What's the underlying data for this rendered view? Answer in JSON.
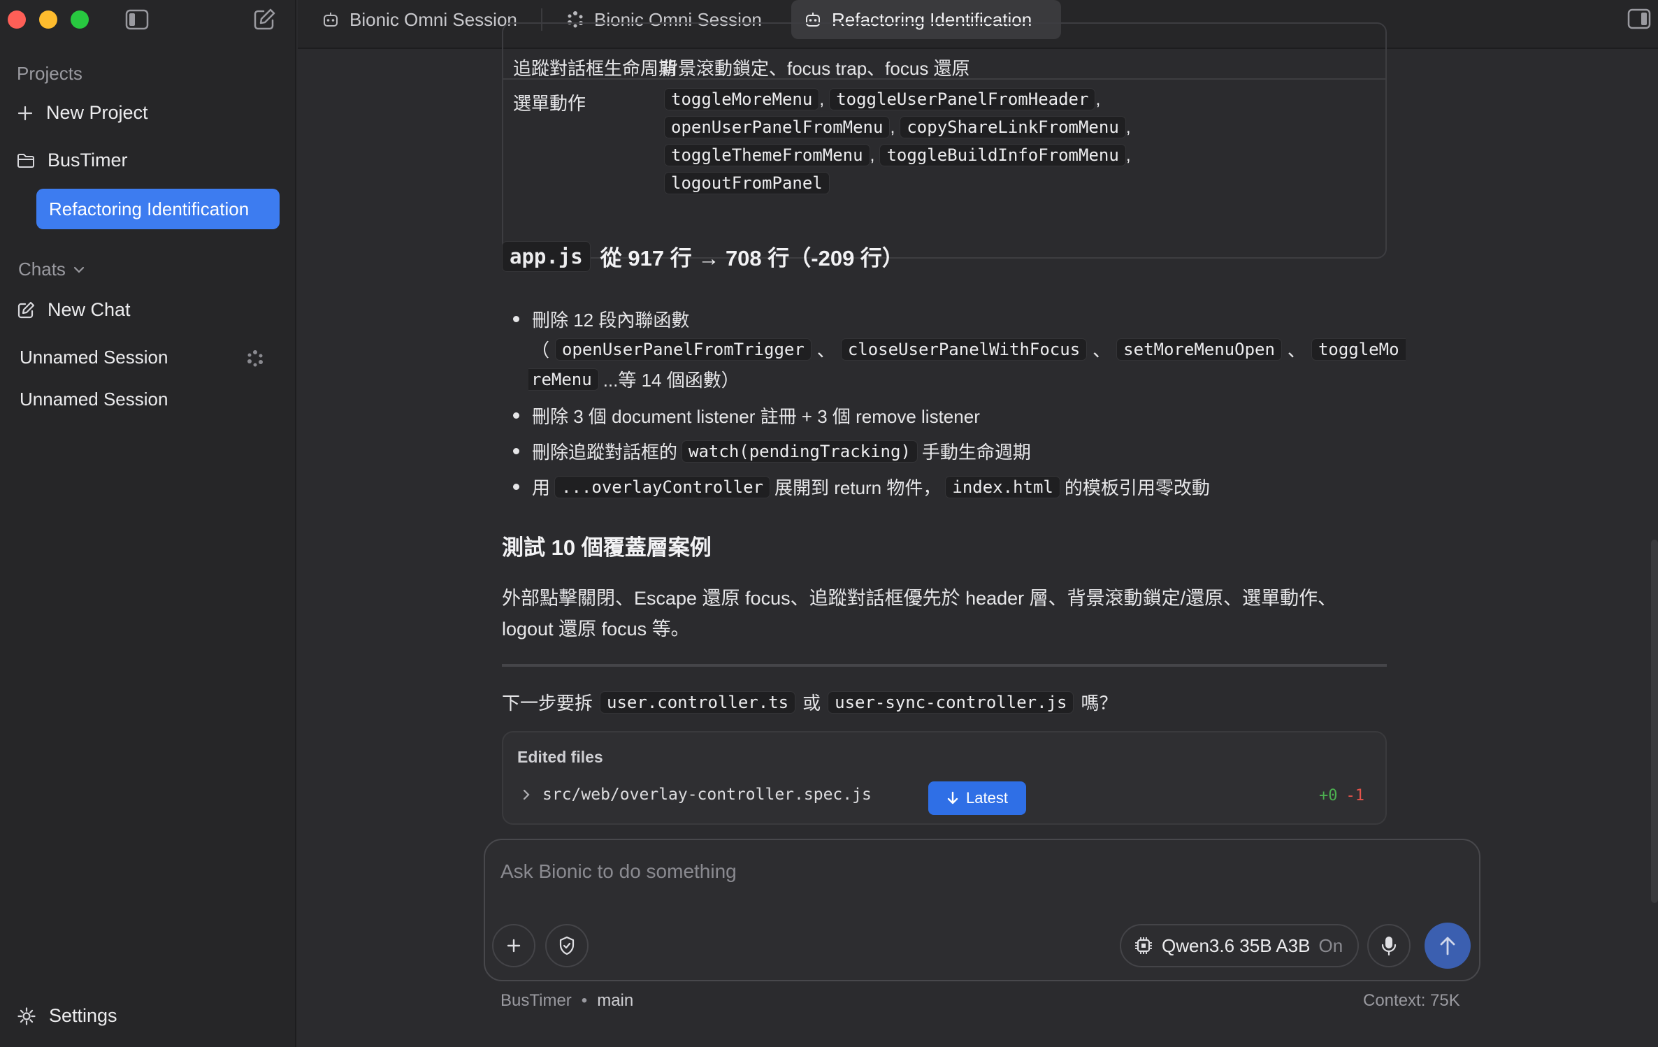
{
  "sidebar": {
    "projects_label": "Projects",
    "new_project": "New Project",
    "project_name": "BusTimer",
    "active_session": "Refactoring Identification",
    "chats_label": "Chats",
    "new_chat": "New Chat",
    "sessions": [
      "Unnamed Session",
      "Unnamed Session"
    ],
    "settings": "Settings"
  },
  "tabs": [
    {
      "label": "Bionic Omni Session",
      "icon": "robot-icon"
    },
    {
      "label": "Bionic Omni Session",
      "icon": "sparkle-icon"
    },
    {
      "label": "Refactoring Identification",
      "icon": "robot-icon",
      "active": true
    }
  ],
  "table": {
    "row1": {
      "key": "追蹤對話框生命周期",
      "value": "背景滾動鎖定、focus trap、focus 還原"
    },
    "row2": {
      "key": "選單動作",
      "funcs": [
        "toggleMoreMenu",
        "toggleUserPanelFromHeader",
        "openUserPanelFromMenu",
        "copyShareLinkFromMenu",
        "toggleThemeFromMenu",
        "toggleBuildInfoFromMenu",
        "logoutFromPanel"
      ],
      "sep": ","
    }
  },
  "section1": {
    "file": "app.js",
    "title_rest": "從 917 行 → 708 行（-209 行）",
    "bullets": {
      "b1_text": "刪除 12 段內聯函數",
      "b1_open": "（",
      "b1_funcs": [
        "openUserPanelFromTrigger",
        "closeUserPanelWithFocus",
        "setMoreMenuOpen",
        "toggleMo"
      ],
      "b1_wrap_code": "reMenu",
      "b1_tail": "...等 14 個函數）",
      "dun": "、",
      "b2": "刪除 3 個 document listener 註冊 + 3 個 remove listener",
      "b3_pre": "刪除追蹤對話框的",
      "b3_code": "watch(pendingTracking)",
      "b3_post": "手動生命週期",
      "b4_pre": "用",
      "b4_code1": "...overlayController",
      "b4_mid": "展開到 return 物件，",
      "b4_code2": "index.html",
      "b4_post": "的模板引用零改動"
    }
  },
  "section2": {
    "title": "測試 10 個覆蓋層案例",
    "line1": "外部點擊關閉、Escape 還原 focus、追蹤對話框優先於 header 層、背景滾動鎖定/還原、選單動作、",
    "line2": "logout 還原 focus 等。"
  },
  "question": {
    "pre": "下一步要拆",
    "code1": "user.controller.ts",
    "mid": "或",
    "code2": "user-sync-controller.js",
    "post": "嗎？"
  },
  "edited_files": {
    "title": "Edited files",
    "path": "src/web/overlay-controller.spec.js",
    "latest": "Latest",
    "added": "+0",
    "removed": "-1"
  },
  "composer": {
    "placeholder": "Ask Bionic to do something",
    "model": "Qwen3.6 35B A3B",
    "model_state": "On"
  },
  "footer": {
    "project": "BusTimer",
    "sep": "•",
    "branch": "main",
    "context": "Context: 75K"
  },
  "colors": {
    "accent": "#3d7cf0",
    "added": "#4caf50",
    "removed": "#e5534b"
  }
}
